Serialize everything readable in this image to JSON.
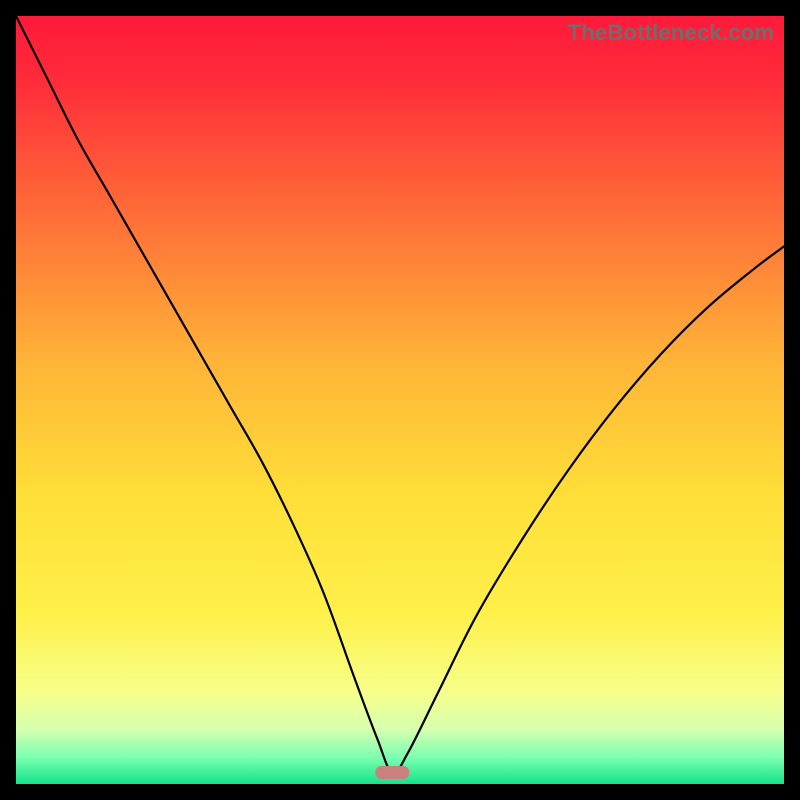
{
  "watermark": "TheBottleneck.com",
  "chart_data": {
    "type": "line",
    "title": "",
    "xlabel": "",
    "ylabel": "",
    "xlim": [
      0,
      100
    ],
    "ylim": [
      0,
      100
    ],
    "grid": false,
    "legend": false,
    "annotations": [],
    "background_gradient": {
      "description": "vertical gradient top to bottom",
      "stops": [
        {
          "pos": 0.0,
          "color": "#ff1a3a"
        },
        {
          "pos": 0.08,
          "color": "#ff2a3a"
        },
        {
          "pos": 0.25,
          "color": "#ff6a38"
        },
        {
          "pos": 0.45,
          "color": "#ffb438"
        },
        {
          "pos": 0.62,
          "color": "#ffde38"
        },
        {
          "pos": 0.78,
          "color": "#fff04a"
        },
        {
          "pos": 0.88,
          "color": "#f7ff8a"
        },
        {
          "pos": 0.93,
          "color": "#d4ffb0"
        },
        {
          "pos": 0.965,
          "color": "#7cffb0"
        },
        {
          "pos": 1.0,
          "color": "#15e48a"
        }
      ]
    },
    "minimum_marker": {
      "x": 49,
      "y": 1.5,
      "color": "#c98080",
      "shape": "rounded-bar"
    },
    "series": [
      {
        "name": "bottleneck-curve",
        "color": "#000000",
        "x": [
          0,
          4,
          8,
          12,
          16,
          20,
          24,
          28,
          32,
          36,
          40,
          44,
          47,
          49,
          51,
          55,
          60,
          66,
          72,
          78,
          84,
          90,
          96,
          100
        ],
        "y": [
          100,
          92,
          84,
          77,
          70,
          63,
          56,
          49,
          42,
          34,
          25,
          14,
          6,
          1.5,
          4,
          12,
          22,
          32,
          41,
          49,
          56,
          62,
          67,
          70
        ]
      }
    ]
  }
}
